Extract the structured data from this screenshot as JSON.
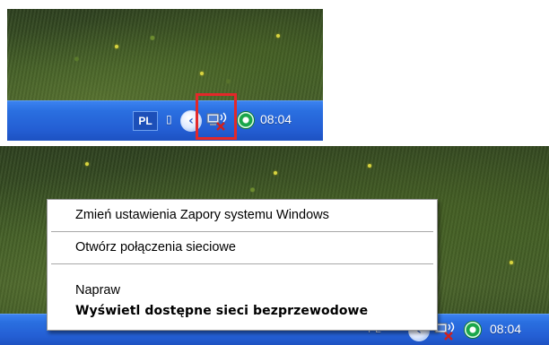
{
  "top_panel": {
    "tray": {
      "language": "PL",
      "clock": "08:04",
      "icons": [
        "language-bar-icon",
        "show-hidden-icons-chevron",
        "wireless-network-disconnected-icon",
        "security-center-icon"
      ]
    },
    "highlight_color": "#e3282a"
  },
  "bottom_panel": {
    "context_menu": {
      "items": [
        {
          "label": "Zmień ustawienia Zapory systemu Windows",
          "bold": false
        },
        {
          "label": "Otwórz połączenia sieciowe",
          "bold": false
        },
        {
          "label": "Napraw",
          "bold": false
        },
        {
          "label": "Wyświetl dostępne sieci bezprzewodowe",
          "bold": true
        }
      ]
    },
    "tray": {
      "language": "PL",
      "clock": "08:04"
    }
  },
  "colors": {
    "taskbar": "#245fd4",
    "menu_background": "#ffffff",
    "error_x": "#d0201e",
    "status_green": "#1aa64a"
  }
}
